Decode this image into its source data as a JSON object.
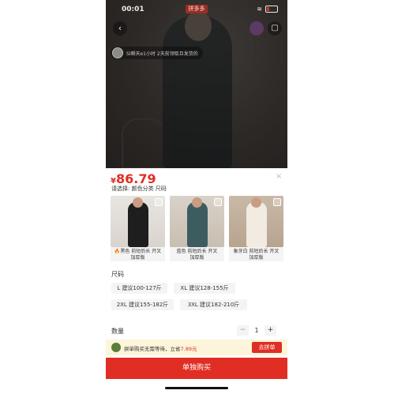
{
  "status_bar": {
    "time": "00:01",
    "app_badge": "拼多多"
  },
  "notice": {
    "text": "Si瞬天e1小时 2天前领取且发货的"
  },
  "sheet": {
    "price_currency": "¥",
    "price_value": "86.79",
    "close_label": "×",
    "select_hint": "请选择: 颜色分类 尺码",
    "variants": [
      {
        "fire": "🔥",
        "label_line1": "黑色 前短后长 开叉",
        "label_line2": "加厚版"
      },
      {
        "fire": "",
        "label_line1": "蓝色 前短后长 开叉",
        "label_line2": "加厚版"
      },
      {
        "fire": "",
        "label_line1": "象牙白 前短后长 开叉",
        "label_line2": "加厚版"
      }
    ],
    "size_title": "尺码",
    "sizes": [
      "L 建议100-127斤",
      "XL 建议128-155斤",
      "2XL 建议155-182斤",
      "3XL 建议182-210斤"
    ],
    "qty_label": "数量",
    "qty_minus": "−",
    "qty_value": "1",
    "qty_plus": "+",
    "group_text_prefix": "拼单购买无需等待，立省",
    "group_amount": "7.89元",
    "group_button": "去拼单",
    "buy_alone": "单独购买"
  },
  "colors": {
    "accent": "#e02e24",
    "group_bar_bg": "#fdf5d9"
  }
}
